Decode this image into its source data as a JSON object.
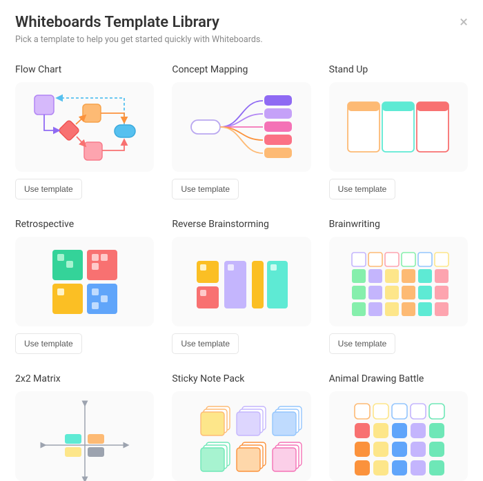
{
  "modal": {
    "title": "Whiteboards Template Library",
    "subtitle": "Pick a template to help you get started quickly with Whiteboards.",
    "close_label": "×"
  },
  "colors": {
    "purple": "#c5a1f8",
    "violet": "#8f6af3",
    "orange": "#fdb55a",
    "red": "#f87171",
    "pink": "#f472b6",
    "magenta": "#fa74b4",
    "teal": "#5eead4",
    "green": "#86efac",
    "blue": "#60a5fa",
    "lblue": "#93c5fd",
    "yellow": "#fde68a",
    "sky": "#56c0ef"
  },
  "use_template_label": "Use template",
  "templates": [
    {
      "title": "Flow Chart",
      "id": "flow-chart"
    },
    {
      "title": "Concept Mapping",
      "id": "concept-mapping"
    },
    {
      "title": "Stand Up",
      "id": "stand-up"
    },
    {
      "title": "Retrospective",
      "id": "retrospective"
    },
    {
      "title": "Reverse Brainstorming",
      "id": "reverse-brainstorming"
    },
    {
      "title": "Brainwriting",
      "id": "brainwriting"
    },
    {
      "title": "2x2 Matrix",
      "id": "two-by-two-matrix"
    },
    {
      "title": "Sticky Note Pack",
      "id": "sticky-note-pack"
    },
    {
      "title": "Animal Drawing Battle",
      "id": "animal-drawing-battle"
    }
  ]
}
